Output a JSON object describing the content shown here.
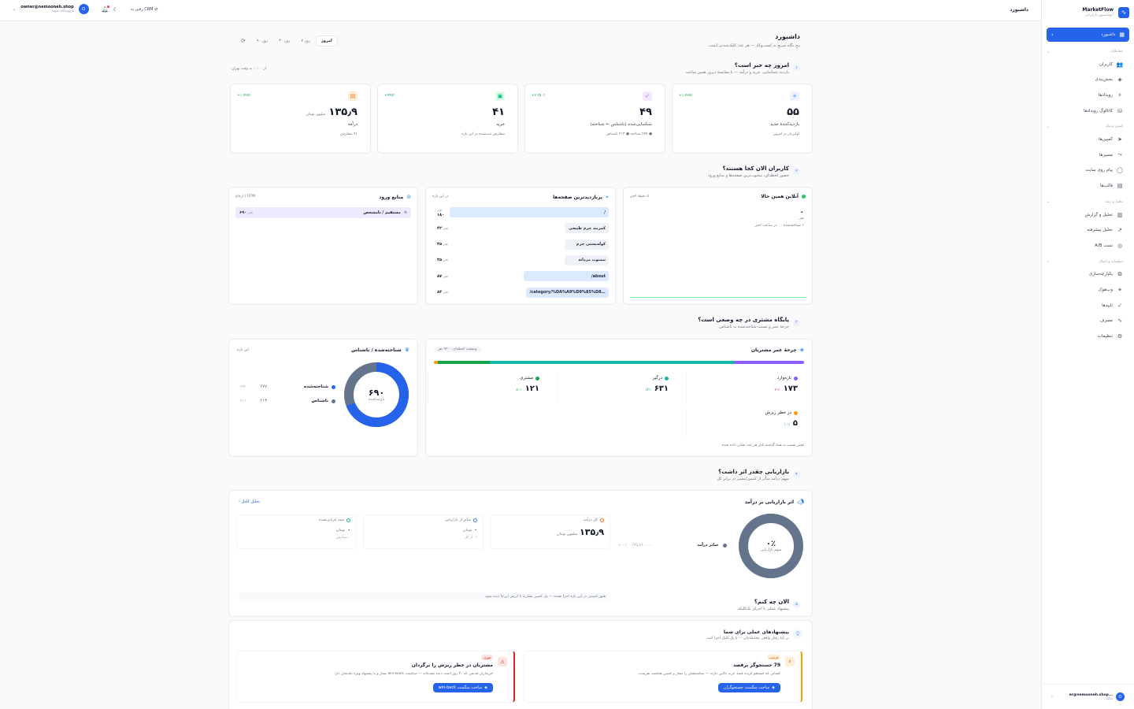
{
  "brand": {
    "title": "MarketFlow",
    "subtitle": "اتوماسیون بازاریابی"
  },
  "nav": {
    "active": "داشبورد",
    "groups": [
      {
        "title": "مخاطبان",
        "items": [
          {
            "label": "کاربران",
            "icon": "users-icon",
            "glyph": "👥"
          },
          {
            "label": "بخش‌بندی",
            "icon": "layers-icon",
            "glyph": "◈"
          },
          {
            "label": "رویدادها",
            "icon": "zap-icon",
            "glyph": "⚡"
          },
          {
            "label": "کاتالوگ رویدادها",
            "icon": "database-icon",
            "glyph": "⛁"
          }
        ]
      },
      {
        "title": "کمپین و پیام",
        "items": [
          {
            "label": "کمپین‌ها",
            "icon": "send-icon",
            "glyph": "➤"
          },
          {
            "label": "مسیرها",
            "icon": "route-icon",
            "glyph": "⤳"
          },
          {
            "label": "پیام روی سایت",
            "icon": "chat-icon",
            "glyph": "◯"
          },
          {
            "label": "قالب‌ها",
            "icon": "file-icon",
            "glyph": "▤"
          }
        ]
      },
      {
        "title": "تحلیل و رشد",
        "items": [
          {
            "label": "تحلیل و گزارش",
            "icon": "bar-chart-icon",
            "glyph": "▥"
          },
          {
            "label": "تحلیل پیشرفته",
            "icon": "trend-icon",
            "glyph": "↗"
          },
          {
            "label": "تست A/B",
            "icon": "target-icon",
            "glyph": "◎"
          }
        ]
      },
      {
        "title": "تنظیمات و اتصال",
        "items": [
          {
            "label": "یکپارچه‌سازی",
            "icon": "puzzle-icon",
            "glyph": "⧉"
          },
          {
            "label": "وب‌هوک",
            "icon": "webhook-icon",
            "glyph": "⚭"
          },
          {
            "label": "تاییدها",
            "icon": "check-circle-icon",
            "glyph": "✓"
          },
          {
            "label": "مصرف",
            "icon": "activity-icon",
            "glyph": "∿"
          },
          {
            "label": "تنظیمات",
            "icon": "gear-icon",
            "glyph": "⚙"
          }
        ]
      }
    ],
    "user": {
      "email": "...er@nemooneh.shop",
      "role": "مالک",
      "initial": "O"
    }
  },
  "topbar": {
    "title": "داشبورد",
    "crm": "رفتن به CRM",
    "email": "owner@nemooneh.shop",
    "shop": "فروشگاه نمونه",
    "initial": "O"
  },
  "page": {
    "title": "داشبورد",
    "subtitle": "پنج نگاه سریع به کسب‌وکار — هر عدد کلیک‌شدنی است.",
    "tabs": [
      "امروز",
      "۷ روز",
      "۳۰ روز",
      "۹۰ روز"
    ],
    "active_tab": "امروز"
  },
  "s1": {
    "num": "۱",
    "title": "امروز چه خبر است؟",
    "subtitle": "بازدید، شناسایی، خرید و درآمد — با مقایسهٔ دیروز همین ساعت",
    "note": "از ۰۰:۰۰ به وقت تهران",
    "cards": [
      {
        "value": "۵۵",
        "label": "بازدیدکنندهٔ جدید",
        "detail": "اولین‌بار در امروز",
        "change": "+۱,۷۷۵٪",
        "color": "#3b82f6",
        "bg": "#eef2ff",
        "glyph": "+",
        "icon": "user-plus-icon"
      },
      {
        "value": "۴۹",
        "label": "شناسایی‌شده (ناشناس ← شناخته)",
        "detail": "● ۴۷۷ شناخته  ● ۲۱۳ ناشناس",
        "change": "+۲,۳۵۰٪",
        "color": "#8b5cf6",
        "bg": "#f3e8ff",
        "glyph": "✓",
        "icon": "user-check-icon"
      },
      {
        "value": "۴۱",
        "label": "خرید",
        "detail": "سفارش ثبت‌شده در این بازه",
        "change": "+۹۴۵٪",
        "color": "#10b981",
        "bg": "#dcfce7",
        "glyph": "▣",
        "icon": "shopping-bag-icon"
      },
      {
        "value": "۱۳۵٫۹",
        "unit": "میلیون تومان",
        "label": "درآمد",
        "detail": "۴۱ سفارش",
        "change": "+۱,۲۲۵٪",
        "color": "#f97316",
        "bg": "#ffedd5",
        "glyph": "▤",
        "icon": "wallet-icon"
      }
    ]
  },
  "s2": {
    "num": "۲",
    "title": "کاربران الان کجا هستند؟",
    "subtitle": "حضور لحظه‌ای، محبوب‌ترین صفحه‌ها و منابع ورود",
    "online": {
      "title": "آنلاین همین حالا",
      "meta": "۵ دقیقهٔ اخیر",
      "value": "۰",
      "unit": "نفر",
      "detail": "• شناخته‌شده · ۰ در ساعت اخیر"
    },
    "pages": {
      "title": "پربازدیدترین صفحه‌ها",
      "meta": "در این بازه",
      "rows": [
        {
          "path": "/",
          "count": "۱۸۰",
          "unit": "نفر"
        },
        {
          "path": "کمربند چرم طبیعی",
          "count": "۴۲",
          "unit": "نفر"
        },
        {
          "path": "کوله‌پشتی چرم",
          "count": "۳۵",
          "unit": "نفر"
        },
        {
          "path": "تیمبوت مردانه",
          "count": "۳۵",
          "unit": "نفر"
        },
        {
          "path": "/about",
          "count": "۸۷",
          "unit": "نفر"
        },
        {
          "path": "/category/%DA%A9%D9%85%D8%B1%D8%A8%D9%86%...",
          "count": "۸۴",
          "unit": "نفر"
        }
      ]
    },
    "sources": {
      "title": "منابع ورود",
      "meta": "UTM / ارجاع",
      "rows": [
        {
          "label": "مستقیم / نامشخص",
          "count": "۶۹۰",
          "unit": "نفر"
        }
      ]
    }
  },
  "s3": {
    "num": "۳",
    "title": "پایگاه مشتری در چه وضعی است؟",
    "subtitle": "چرخهٔ عمر و نسبت شناخته‌شده به ناشناس",
    "lifecycle": {
      "title": "چرخهٔ عمر مشتریان",
      "badge": "وضعیت لحظه‌ای · ۹۳۰ نفر",
      "items": [
        {
          "label": "تازه‌وارد",
          "value": "۱۷۳",
          "change": "۲۱٪",
          "color": "#8b5cf6"
        },
        {
          "label": "درگیر",
          "value": "۶۳۱",
          "change": "۱۳٪",
          "color": "#14b8a6"
        },
        {
          "label": "مشتری",
          "value": "۱۲۱",
          "change": "۵۰٪",
          "color": "#16a34a"
        },
        {
          "label": "در خطر ریزش",
          "value": "۵",
          "change": "۱۰٪",
          "color": "#f59e0b"
        }
      ],
      "footer": "تغییر نسبت به همهٔ گذشته کنار هر عدد نشان داده شده."
    },
    "identity": {
      "title": "شناخته‌شده / ناشناس",
      "meta": "این بازه",
      "total": "۶۹۰",
      "total_label": "بازدیدکننده",
      "rows": [
        {
          "label": "شناخته‌شده",
          "value": "۴۷۷",
          "pct": "۶۹٪",
          "color": "#2563eb"
        },
        {
          "label": "ناشناس",
          "value": "۲۱۳",
          "pct": "۳۱٪",
          "color": "#64748b"
        }
      ]
    }
  },
  "s4": {
    "num": "۴",
    "title": "بازاریابی چقدر اثر داشت؟",
    "subtitle": "سهم درآمد متأثر از کمپین/مسیر در برابر کل",
    "card_title": "اثر بازاریابی بر درآمد",
    "link": "تحلیل کامل ›",
    "ring_value": "۰٪",
    "ring_label": "سهم بازاریابی",
    "other_label": "سایر درآمد",
    "other_value": "۱۳۵,۸۶۰,۰۰۰",
    "other_pct": "۱۰۰٪",
    "kpis": [
      {
        "title": "کل درآمد",
        "value": "۱۳۵٫۹",
        "unit": "میلیون تومان",
        "detail": "",
        "icon": "wallet-icon",
        "color": "#f97316"
      },
      {
        "title": "متأثر از بازاریابی",
        "value": "۰",
        "unit": "تومان",
        "detail": "۰٪ از کل",
        "icon": "target-icon",
        "color": "#3b82f6"
      },
      {
        "title": "سبد بازیابی‌شده",
        "value": "۰",
        "unit": "تومان",
        "detail": "۰ سفارش",
        "icon": "refresh-icon",
        "color": "#10b981"
      }
    ],
    "note": "هنوز کمپینی در این بازه اجرا نشده — یک کمپین بسازید تا اثرش این‌جا دیده شود."
  },
  "s5": {
    "num": "۵",
    "title": "الان چه کنم؟",
    "subtitle": "پیشنهاد عملی با اجرای یک‌کلیکه",
    "card_title": "پیشنهادهای عملی برای شما",
    "card_sub": "بر پایهٔ رفتار واقعی مخاطبانتان — با یک کلیک اجرا کنید",
    "items": [
      {
        "badge": "فرصت",
        "title": "79 جستجوگر پرقصد",
        "text": "کسانی که جستجو کردند قصد خرید بالایی دارند — سگمنتشان را بساز و کمپین هدفمند بفرست.",
        "button": "ساخت سگمنت جستجوگران",
        "accent": "#f59e0b",
        "badge_bg": "#ffedd5",
        "badge_fg": "#c2410c",
        "icon": "search-icon"
      },
      {
        "badge": "فوری",
        "title": "مشتریان در خطر ریزش را برگردان",
        "text": "خریداران قدیمی که ۳۰ روز است دیده نشده‌اند — سگمنت win-back بساز و با پیشنهاد ویژه نگه‌شان دار.",
        "button": "ساخت سگمنت win-back",
        "accent": "#dc2626",
        "badge_bg": "#fee2e2",
        "badge_fg": "#b91c1c",
        "icon": "alert-icon"
      }
    ]
  }
}
